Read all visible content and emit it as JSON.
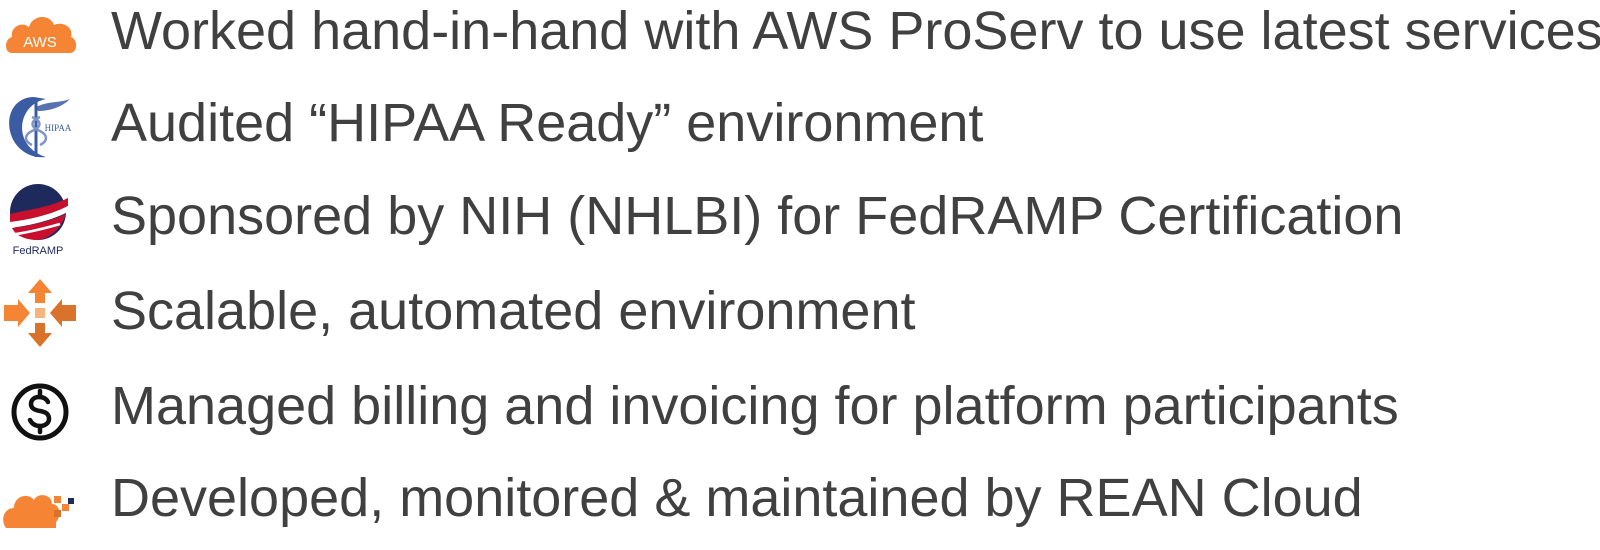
{
  "bullets": [
    {
      "icon": "aws-cloud-icon",
      "icon_label": "AWS",
      "text": "Worked hand-in-hand with AWS ProServ to use latest services"
    },
    {
      "icon": "hipaa-caduceus-icon",
      "icon_label": "HIPAA",
      "text": "Audited “HIPAA Ready” environment"
    },
    {
      "icon": "fedramp-icon",
      "icon_label": "FedRAMP",
      "text": "Sponsored by NIH (NHLBI) for FedRAMP Certification"
    },
    {
      "icon": "scaling-arrows-icon",
      "text": "Scalable, automated environment"
    },
    {
      "icon": "dollar-circle-icon",
      "text": "Managed billing and invoicing for platform participants"
    },
    {
      "icon": "rean-cloud-icon",
      "text": "Developed, monitored & maintained by REAN Cloud"
    }
  ],
  "colors": {
    "text": "#404040",
    "aws_orange": "#F58534",
    "hipaa_blue": "#3B5BA5",
    "fedramp_navy": "#1F2A5C",
    "fedramp_red": "#C8102E"
  }
}
